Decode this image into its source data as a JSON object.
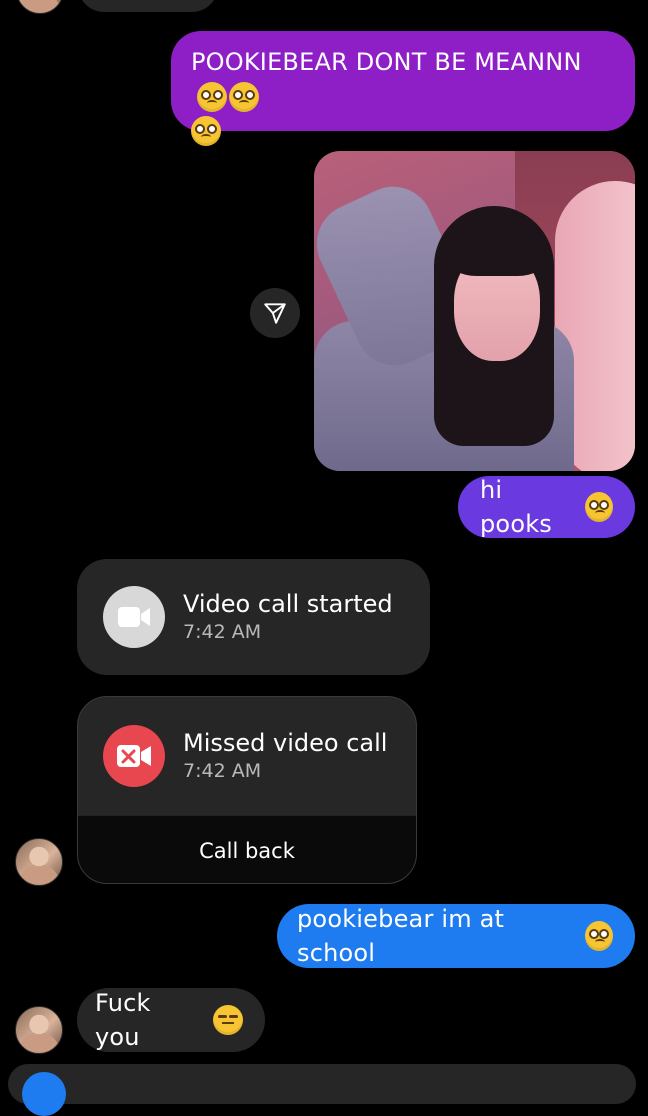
{
  "messages": {
    "m1": {
      "text": "POOKIEBEAR DONT BE MEANNN"
    },
    "m2": {
      "text": "hi pooks"
    },
    "m3": {
      "title": "Video call started",
      "time": "7:42 AM"
    },
    "m4": {
      "title": "Missed video call",
      "time": "7:42 AM",
      "action": "Call back"
    },
    "m5": {
      "text": "pookiebear im at school"
    },
    "m6": {
      "text": "Fuck you"
    }
  },
  "icons": {
    "share": "paper-plane-icon",
    "video_started": "video-camera-icon",
    "video_missed": "missed-video-icon",
    "emoji_plead": "pleading-face-emoji",
    "emoji_unamused": "unamused-face-emoji"
  },
  "colors": {
    "background": "#000000",
    "bubble_purple": "#8e1ec6",
    "bubble_violet": "#6a39e0",
    "bubble_blue": "#1f7cf0",
    "bubble_incoming": "#262626",
    "missed_red": "#e8474f",
    "started_gray": "#d8d8d8"
  }
}
